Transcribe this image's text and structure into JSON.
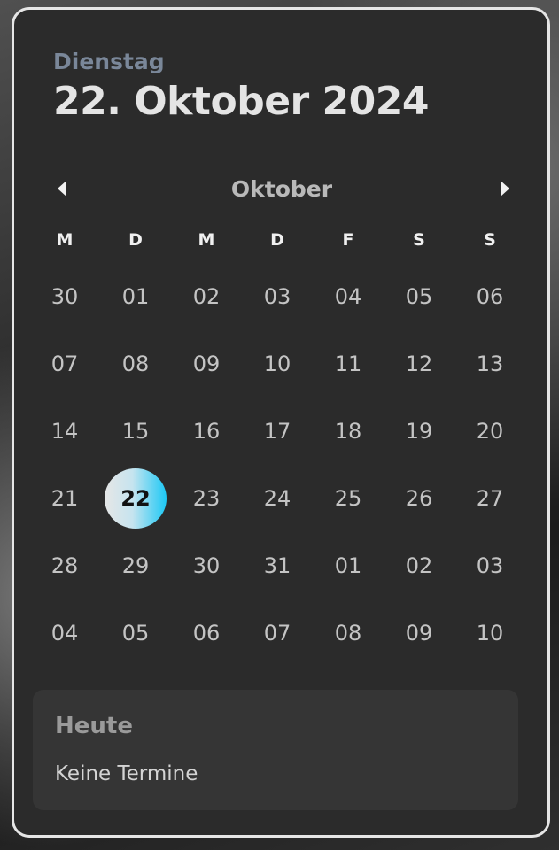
{
  "header": {
    "day_name": "Dienstag",
    "full_date": "22. Oktober 2024"
  },
  "nav": {
    "month": "Oktober",
    "prev_icon": "triangle-left",
    "next_icon": "triangle-right"
  },
  "weekdays": [
    "M",
    "D",
    "M",
    "D",
    "F",
    "S",
    "S"
  ],
  "weeks": [
    [
      "30",
      "01",
      "02",
      "03",
      "04",
      "05",
      "06"
    ],
    [
      "07",
      "08",
      "09",
      "10",
      "11",
      "12",
      "13"
    ],
    [
      "14",
      "15",
      "16",
      "17",
      "18",
      "19",
      "20"
    ],
    [
      "21",
      "22",
      "23",
      "24",
      "25",
      "26",
      "27"
    ],
    [
      "28",
      "29",
      "30",
      "31",
      "01",
      "02",
      "03"
    ],
    [
      "04",
      "05",
      "06",
      "07",
      "08",
      "09",
      "10"
    ]
  ],
  "selected_day": "22",
  "events": {
    "title": "Heute",
    "empty_text": "Keine Termine"
  },
  "colors": {
    "card_bg": "#2b2b2b",
    "accent": "#1cc8f5",
    "border": "#e6e6e6"
  }
}
